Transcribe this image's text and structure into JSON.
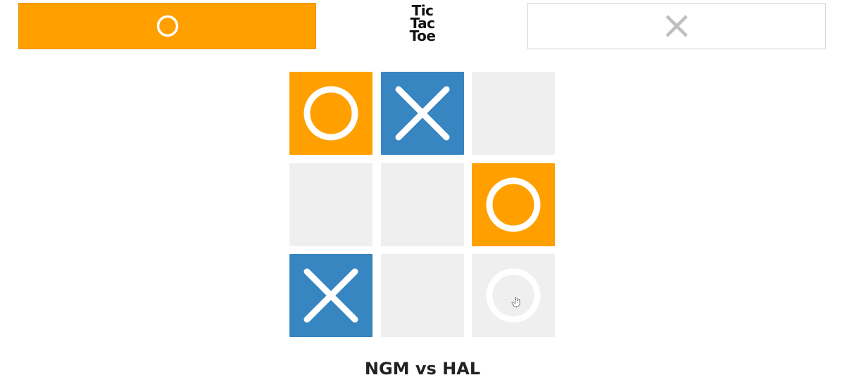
{
  "title": {
    "line1": "Tic",
    "line2": "Tac",
    "line3": "Toe"
  },
  "players": {
    "o": {
      "mark": "O",
      "active": true,
      "icon": "o-icon"
    },
    "x": {
      "mark": "X",
      "active": false,
      "icon": "x-icon"
    }
  },
  "board": {
    "cells": [
      "O",
      "X",
      "",
      "",
      "",
      "O",
      "X",
      "",
      "O-preview"
    ]
  },
  "match": {
    "label": "NGM vs HAL"
  },
  "colors": {
    "o_mark": "#ffa000",
    "x_mark": "#3785c1",
    "empty_cell": "#efefef",
    "symbol": "#ffffff",
    "inactive_icon": "#bfbfbf"
  }
}
